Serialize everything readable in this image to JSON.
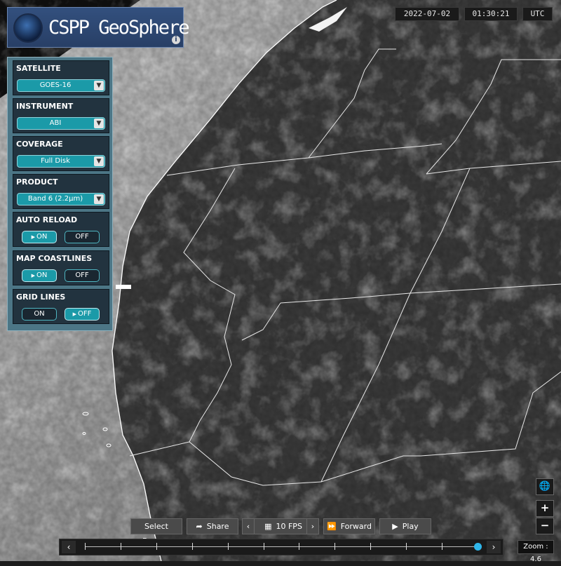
{
  "app": {
    "title": "CSPP GeoSphere",
    "info_icon": "info-icon",
    "logo_icon": "cspp-logo-icon"
  },
  "datetime": {
    "date": "2022-07-02",
    "time": "01:30:21",
    "zone": "UTC"
  },
  "panel": {
    "satellite": {
      "label": "SATELLITE",
      "value": "GOES-16"
    },
    "instrument": {
      "label": "INSTRUMENT",
      "value": "ABI"
    },
    "coverage": {
      "label": "COVERAGE",
      "value": "Full Disk"
    },
    "product": {
      "label": "PRODUCT",
      "value": "Band 6 (2.2μm)"
    },
    "auto_reload": {
      "label": "AUTO RELOAD",
      "on": "ON",
      "off": "OFF",
      "selected": "on"
    },
    "map_coastlines": {
      "label": "MAP COASTLINES",
      "on": "ON",
      "off": "OFF",
      "selected": "on"
    },
    "grid_lines": {
      "label": "GRID LINES",
      "on": "ON",
      "off": "OFF",
      "selected": "off"
    }
  },
  "controls": {
    "select_frames": "Select Frames",
    "share": "Share",
    "fps": "10 FPS",
    "forward": "Forward",
    "play": "Play"
  },
  "timeline": {
    "frame_count": 12,
    "current_frame": 12
  },
  "zoom": {
    "label": "Zoom : 4.6",
    "plus": "+",
    "minus": "−",
    "globe_icon": "globe-icon"
  },
  "colors": {
    "accent": "#1b9aa8",
    "panel": "#4c7686",
    "handle": "#2fb6ea"
  }
}
